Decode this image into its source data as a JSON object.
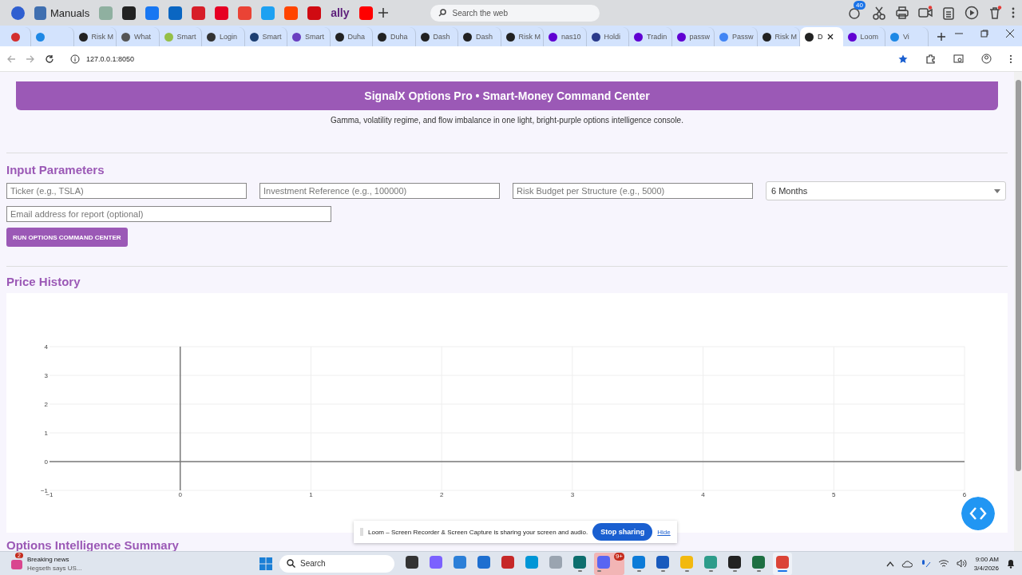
{
  "bookmarks_bar": {
    "items": [
      {
        "kind": "icon",
        "color": "#2f5fd0"
      },
      {
        "kind": "labeled",
        "label": "Manuals",
        "color": "#3f6fb0"
      },
      {
        "kind": "icon",
        "color": "#8fb0a0"
      },
      {
        "kind": "icon",
        "color": "#222222"
      },
      {
        "kind": "icon",
        "color": "#1877f2"
      },
      {
        "kind": "icon",
        "color": "#0a66c2"
      },
      {
        "kind": "icon",
        "color": "#d71e28"
      },
      {
        "kind": "icon",
        "color": "#e60023"
      },
      {
        "kind": "icon",
        "color": "#ea4335"
      },
      {
        "kind": "icon",
        "color": "#1da1f2"
      },
      {
        "kind": "icon",
        "color": "#ff4500"
      },
      {
        "kind": "icon",
        "color": "#d00a12"
      },
      {
        "kind": "wordmark",
        "label": "ally",
        "color": "#5c1d7a"
      },
      {
        "kind": "icon",
        "color": "#ff0000"
      }
    ],
    "search": {
      "placeholder": "Search the web"
    },
    "extension_badge": "40"
  },
  "tabs": [
    {
      "color": "#d32f2f",
      "selected": false
    },
    {
      "color": "#1e88e5",
      "selected": false
    },
    {
      "label": "Risk M",
      "color": "#222222",
      "selected": false
    },
    {
      "label": "What",
      "color": "#555555",
      "selected": false
    },
    {
      "label": "Smart",
      "color": "#95bf47",
      "selected": false
    },
    {
      "label": "Login",
      "color": "#333333",
      "selected": false
    },
    {
      "label": "Smart",
      "color": "#1d3f72",
      "selected": false
    },
    {
      "label": "Smart",
      "color": "#6a3fc0",
      "selected": false
    },
    {
      "label": "Duha",
      "color": "#222222",
      "selected": false
    },
    {
      "label": "Duha",
      "color": "#222222",
      "selected": false
    },
    {
      "label": "Dash",
      "color": "#222222",
      "selected": false
    },
    {
      "label": "Dash",
      "color": "#222222",
      "selected": false
    },
    {
      "label": "Risk M",
      "color": "#222222",
      "selected": false
    },
    {
      "label": "nas10",
      "color": "#6001d2",
      "selected": false
    },
    {
      "label": "Holdi",
      "color": "#2a3a8a",
      "selected": false
    },
    {
      "label": "Tradin",
      "color": "#6001d2",
      "selected": false
    },
    {
      "label": "passw",
      "color": "#6001d2",
      "selected": false
    },
    {
      "label": "Passw",
      "color": "#4285f4",
      "selected": false
    },
    {
      "label": "Risk M",
      "color": "#222222",
      "selected": false
    },
    {
      "label": "D",
      "color": "#222222",
      "selected": true
    },
    {
      "label": "Loom",
      "color": "#6001d2",
      "selected": false
    },
    {
      "label": "Vi",
      "color": "#1e88e5",
      "selected": false
    }
  ],
  "address_bar": {
    "url": "127.0.0.1:8050",
    "bookmarked": true
  },
  "app": {
    "title": "SignalX Options Pro • Smart-Money Command Center",
    "subtitle": "Gamma, volatility regime, and flow imbalance in one light, bright-purple options intelligence console.",
    "input_parameters": {
      "heading": "Input Parameters",
      "fields": [
        {
          "placeholder": "Ticker (e.g., TSLA)"
        },
        {
          "placeholder": "Investment Reference (e.g., 100000)"
        },
        {
          "placeholder": "Risk Budget per Structure (e.g., 5000)"
        }
      ],
      "period_dropdown": {
        "value": "6 Months"
      },
      "email_field": {
        "placeholder": "Email address for report (optional)"
      },
      "run_button": "RUN OPTIONS COMMAND CENTER"
    },
    "price_history": {
      "heading": "Price History",
      "chart_data": {
        "type": "line",
        "grid": true,
        "xlim": [
          -1,
          6
        ],
        "ylim": [
          -1,
          4
        ],
        "xticks": [
          {
            "value": -1,
            "label": "−1"
          },
          0,
          1,
          2,
          3,
          4,
          5,
          6
        ],
        "yticks": [
          {
            "value": -1,
            "label": "−1"
          },
          0,
          1,
          2,
          3,
          4
        ]
      }
    },
    "summary_heading": "Options Intelligence Summary"
  },
  "loom_banner": {
    "message": "Loom – Screen Recorder & Screen Capture is sharing your screen and audio.",
    "stop_button": "Stop sharing",
    "hide_link": "Hide"
  },
  "taskbar": {
    "news": {
      "title": "Breaking news",
      "headline": "Hegseth says US...",
      "badge": "2"
    },
    "search": {
      "placeholder": "Search"
    },
    "apps": [
      {
        "color": "#333333",
        "running": false,
        "focused": false
      },
      {
        "color": "#7b61ff",
        "running": false,
        "focused": false
      },
      {
        "color": "#2b7fd8",
        "running": false,
        "focused": false
      },
      {
        "color": "#1e6fd0",
        "running": false,
        "focused": false
      },
      {
        "color": "#c62828",
        "running": false,
        "focused": false
      },
      {
        "color": "#0096d6",
        "running": false,
        "focused": false
      },
      {
        "color": "#9aa4b0",
        "running": false,
        "focused": false
      },
      {
        "color": "#0d6e6e",
        "running": true,
        "focused": false
      },
      {
        "color": "#5865f2",
        "running": true,
        "focused": false,
        "badge": "9+"
      },
      {
        "color": "#0c7bd8",
        "running": true,
        "focused": false
      },
      {
        "color": "#185abd",
        "running": true,
        "focused": false
      },
      {
        "color": "#f2b90f",
        "running": true,
        "focused": false
      },
      {
        "color": "#2d9c8a",
        "running": true,
        "focused": false
      },
      {
        "color": "#222222",
        "running": true,
        "focused": false
      },
      {
        "color": "#1d6f42",
        "running": true,
        "focused": false
      },
      {
        "color": "#db4437",
        "running": true,
        "focused": true
      }
    ],
    "time": "9:00 AM",
    "date": "3/4/2026"
  }
}
